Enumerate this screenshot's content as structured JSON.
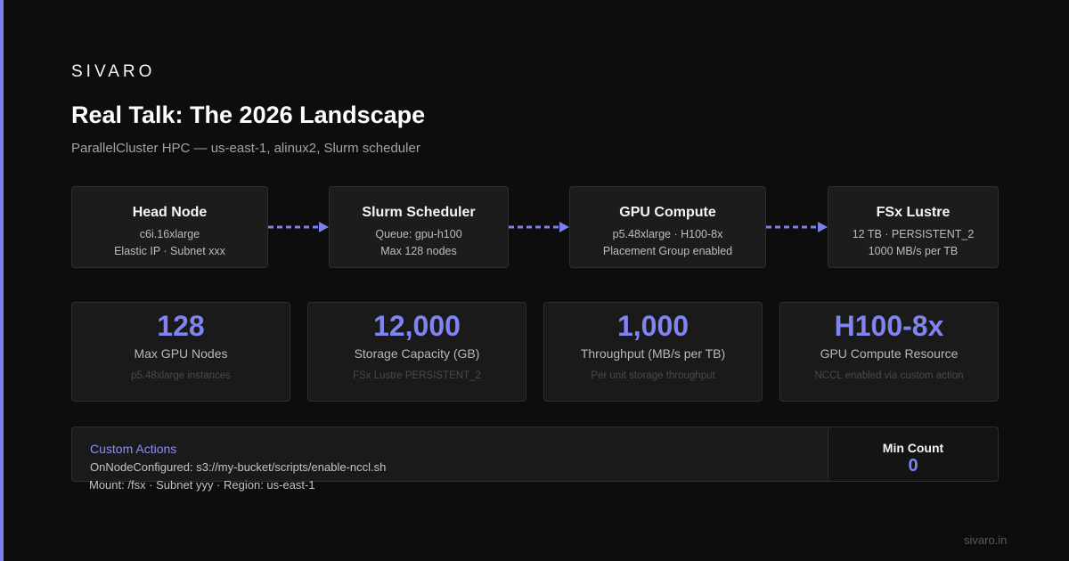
{
  "brand": "SIVARO",
  "title": "Real Talk: The 2026 Landscape",
  "subtitle": "ParallelCluster HPC — us-east-1, alinux2, Slurm scheduler",
  "flow": [
    {
      "title": "Head Node",
      "line1": "c6i.16xlarge",
      "line2": "Elastic IP · Subnet xxx"
    },
    {
      "title": "Slurm Scheduler",
      "line1": "Queue: gpu-h100",
      "line2": "Max 128 nodes"
    },
    {
      "title": "GPU Compute",
      "line1": "p5.48xlarge · H100-8x",
      "line2": "Placement Group enabled"
    },
    {
      "title": "FSx Lustre",
      "line1": "12 TB · PERSISTENT_2",
      "line2": "1000 MB/s per TB"
    }
  ],
  "stats": [
    {
      "value": "128",
      "label": "Max GPU Nodes",
      "note": "p5.48xlarge instances"
    },
    {
      "value": "12,000",
      "label": "Storage Capacity (GB)",
      "note": "FSx Lustre PERSISTENT_2"
    },
    {
      "value": "1,000",
      "label": "Throughput (MB/s per TB)",
      "note": "Per unit storage throughput"
    },
    {
      "value": "H100-8x",
      "label": "GPU Compute Resource",
      "note": "NCCL enabled via custom action"
    }
  ],
  "actions": {
    "heading": "Custom Actions",
    "line1": "OnNodeConfigured: s3://my-bucket/scripts/enable-nccl.sh",
    "line2": "Mount: /fsx · Subnet yyy · Region: us-east-1"
  },
  "min_count": {
    "label": "Min Count",
    "value": "0"
  },
  "footer": "sivaro.in",
  "colors": {
    "accent": "#7b80ee",
    "background": "#0d0d0d",
    "card": "#1c1c1d"
  }
}
